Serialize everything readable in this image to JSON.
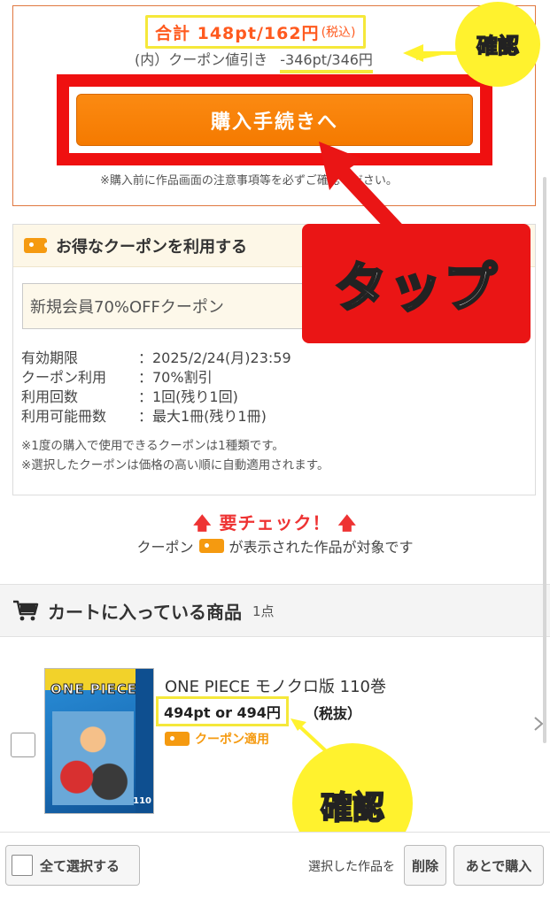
{
  "summary": {
    "total_main": "合計 148pt/162円",
    "total_tax": "(税込)",
    "discount_label": "(内）クーポン値引き",
    "discount_value": "-346pt/346円",
    "buy_button": "購入手続きへ",
    "buy_note": "※購入前に作品画面の注意事項等を必ずご確認ください。"
  },
  "coupon": {
    "title": "お得なクーポンを利用する",
    "selected": "新規会員70%OFFクーポン",
    "details": [
      {
        "key": "有効期限",
        "value": "：2025/2/24(月)23:59"
      },
      {
        "key": "クーポン利用",
        "value": "：70%割引"
      },
      {
        "key": "利用回数",
        "value": "：1回(残り1回)"
      },
      {
        "key": "利用可能冊数",
        "value": "：最大1冊(残り1冊)"
      }
    ],
    "notes": [
      "※1度の購入で使用できるクーポンは1種類です。",
      "※選択したクーポンは価格の高い順に自動適用されます。"
    ]
  },
  "annotations": {
    "tap": "タップ",
    "confirm_top": "確認",
    "confirm_bottom": "確認"
  },
  "check": {
    "heading": "要チェック！",
    "sub_before": "クーポン",
    "sub_after": "が表示された作品が対象です"
  },
  "cart": {
    "title": "カートに入っている商品",
    "count": "1点",
    "item": {
      "title": "ONE PIECE モノクロ版 110巻",
      "price": "494pt or 494円",
      "tax": "（税抜）",
      "coupon_label": "クーポン適用",
      "cover_logo": "ONE PIECE",
      "cover_number": "110"
    }
  },
  "bottom_bar": {
    "select_all": "全て選択する",
    "selected_label": "選択した作品を",
    "delete": "削除",
    "buy_later": "あとで購入"
  },
  "colors": {
    "accent_orange": "#f57a00",
    "price_orange": "#ff5a1f",
    "highlight_yellow": "#f5e83a",
    "callout_red": "#ea1515",
    "coupon_icon": "#f59a10"
  }
}
